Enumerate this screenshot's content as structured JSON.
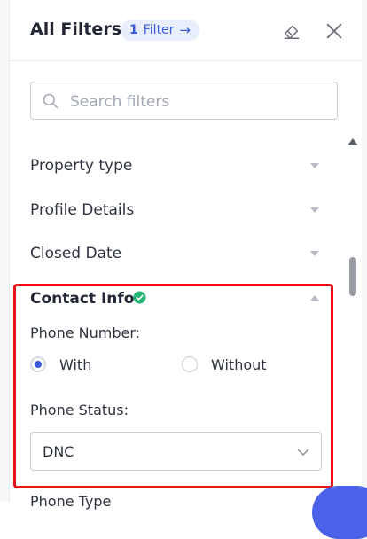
{
  "header": {
    "title": "All Filters",
    "badge": {
      "count": "1",
      "label": "Filter",
      "arrow": "→"
    }
  },
  "search": {
    "placeholder": "Search filters",
    "value": ""
  },
  "sections": [
    {
      "label": "Property type",
      "expanded": false
    },
    {
      "label": "Profile Details",
      "expanded": false
    },
    {
      "label": "Closed Date",
      "expanded": false
    }
  ],
  "contact_info": {
    "title": "Contact Info",
    "phone_number_label": "Phone Number:",
    "options": [
      {
        "label": "With",
        "selected": true
      },
      {
        "label": "Without",
        "selected": false
      }
    ],
    "phone_status_label": "Phone Status:",
    "phone_status_value": "DNC"
  },
  "next_section": {
    "label": "Phone Type"
  },
  "colors": {
    "accent": "#3b5bdb",
    "highlight": "#e8141a",
    "check": "#22b573"
  }
}
